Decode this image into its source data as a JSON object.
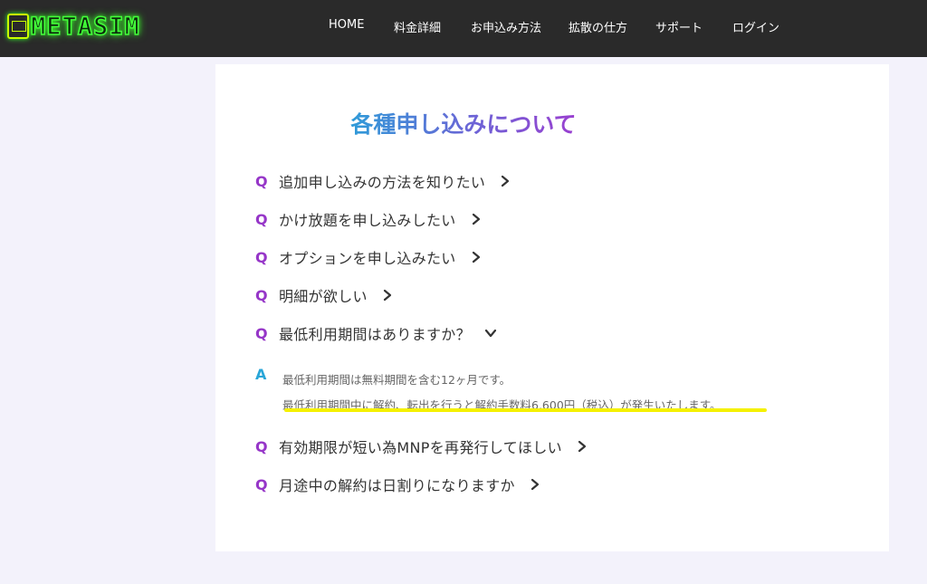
{
  "header": {
    "logo_text": "METASIM",
    "nav": [
      "HOME",
      "料金詳細",
      "お申込み方法",
      "拡散の仕方",
      "サポート",
      "ログイン"
    ]
  },
  "page": {
    "title": "各種申し込みについて"
  },
  "faq": {
    "q_mark": "Q",
    "a_mark": "A",
    "questions": [
      "追加申し込みの方法を知りたい",
      "かけ放題を申し込みしたい",
      "オプションを申し込みたい",
      "明細が欲しい",
      "最低利用期間はありますか？",
      "有効期限が短い為MNPを再発行してほしい",
      "月途中の解約は日割りになりますか"
    ],
    "expanded_index": 4,
    "answer_lines": [
      "最低利用期間は無料期間を含む12ヶ月です。",
      "最低利用期間中に解約、転出を行うと解約手数料6,600円（税込）が発生いたします。"
    ]
  },
  "colors": {
    "header_bg": "#2a2a2a",
    "q_color": "#9636c8",
    "a_color": "#29a6d8",
    "highlight": "#f5f100"
  }
}
